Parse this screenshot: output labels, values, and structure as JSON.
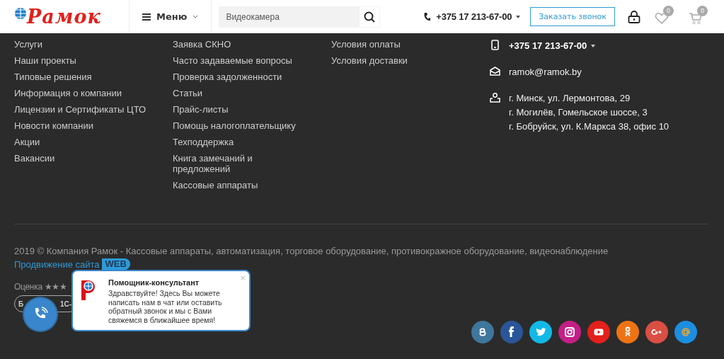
{
  "header": {
    "logo": "Рамок",
    "menu": "Меню",
    "search": {
      "placeholder": "Видеокамера"
    },
    "phone": "+375 17 213-67-00",
    "callback_button": "Заказать звонок",
    "favorites_count": "0",
    "cart_count": "0"
  },
  "footer": {
    "columns": [
      {
        "links": [
          "Услуги",
          "Наши проекты",
          "Типовые решения",
          "Информация о компании",
          "Лицензии и Сертификаты ЦТО",
          "Новости компании",
          "Акции",
          "Вакансии"
        ]
      },
      {
        "links": [
          "Заявка СКНО",
          "Часто задаваемые вопросы",
          "Проверка задолженности",
          "Статьи",
          "Прайс-листы",
          "Помощь налогоплательщику",
          "Техподдержка",
          "Книга замечаний и предложений",
          "Кассовые аппараты"
        ]
      },
      {
        "links": [
          "Условия оплаты",
          "Условия доставки"
        ]
      }
    ],
    "contacts": [
      {
        "kind": "phone",
        "lines": [
          "+375 17 213-67-00"
        ]
      },
      {
        "kind": "email",
        "lines": [
          "ramok@ramok.by"
        ]
      },
      {
        "kind": "address",
        "lines": [
          "г. Минск, ул. Лермонтова, 29",
          "г. Могилёв, Гомельское шоссе, 3",
          "г. Бобруйск, ул. К.Маркса 38, офис 10"
        ]
      }
    ],
    "copyright": "2019 © Компания Рамок - Кассовые аппараты, автоматизация, торговое оборудование, противокражное оборудование, видеонаблюдение",
    "promo_link": "Продвижение сайта",
    "promo_badge": "WEB",
    "rating": "Оценка ★★★",
    "partial_button": "Б 1С-",
    "social": [
      {
        "kind": "vk",
        "color": "#3f769c"
      },
      {
        "kind": "facebook",
        "color": "#2a5699"
      },
      {
        "kind": "twitter",
        "color": "#12b9e6"
      },
      {
        "kind": "instagram",
        "color": "#c41f87"
      },
      {
        "kind": "youtube",
        "color": "#e3201b"
      },
      {
        "kind": "odnoklassniki",
        "color": "#ee7314"
      },
      {
        "kind": "googleplus",
        "color": "#da4f43"
      },
      {
        "kind": "mail",
        "color": "#1c8ee0"
      }
    ]
  },
  "chat_popup": {
    "title": "Помощник-консультант",
    "message": "Здравствуйте! Здесь Вы можете написать нам в чат или оставить обратный звонок и мы с Вами свяжемся в ближайшее время!",
    "close": "×"
  }
}
